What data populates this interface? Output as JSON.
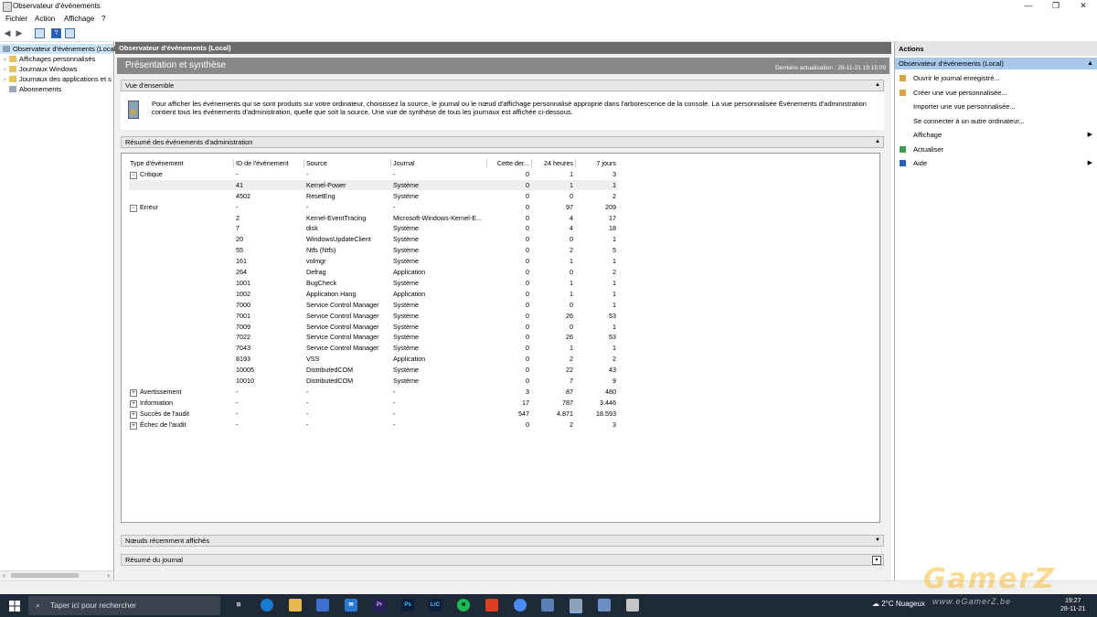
{
  "window": {
    "title": "Observateur d'événements",
    "minimize": "—",
    "restore": "❐",
    "close": "✕"
  },
  "menu": {
    "file": "Fichier",
    "action": "Action",
    "view": "Affichage",
    "help": "?"
  },
  "tree": {
    "root": "Observateur d'événements (Local)",
    "items": [
      "Affichages personnalisés",
      "Journaux Windows",
      "Journaux des applications et s",
      "Abonnements"
    ]
  },
  "center": {
    "header": "Observateur d'événements (Local)",
    "banner_title": "Présentation et synthèse",
    "last_refresh": "Dernière actualisation : 28-11-21 19:15:09",
    "overview_label": "Vue d'ensemble",
    "overview_text": "Pour afficher les événements qui se sont produits sur votre ordinateur, choisissez la source, le journal ou le nœud d'affichage personnalisé approprié dans l'arborescence de la console. La vue personnalisée Événements d'administration contient tous les événements d'administration, quelle que soit la source. Une vue de synthèse de tous les journaux est affichée ci-dessous.",
    "summary_label": "Résumé des événements d'administration",
    "recent_nodes_label": "Nœuds récemment affichés",
    "log_summary_label": "Résumé du journal"
  },
  "table": {
    "headers": [
      "Type d'événement",
      "ID de l'événement",
      "Source",
      "Journal",
      "Cette der...",
      "24 heures",
      "7 jours"
    ],
    "rows": [
      {
        "type": "Critique",
        "group": "minus",
        "id": "-",
        "source": "-",
        "journal": "-",
        "h1": "0",
        "h24": "1",
        "d7": "3"
      },
      {
        "type": "",
        "id": "41",
        "source": "Kernel-Power",
        "journal": "Système",
        "h1": "0",
        "h24": "1",
        "d7": "1",
        "alt": true
      },
      {
        "type": "",
        "id": "4502",
        "source": "ResetEng",
        "journal": "Système",
        "h1": "0",
        "h24": "0",
        "d7": "2"
      },
      {
        "type": "Erreur",
        "group": "minus",
        "id": "-",
        "source": "-",
        "journal": "-",
        "h1": "0",
        "h24": "97",
        "d7": "209"
      },
      {
        "type": "",
        "id": "2",
        "source": "Kernel-EventTracing",
        "journal": "Microsoft-Windows-Kernel-E...",
        "h1": "0",
        "h24": "4",
        "d7": "17"
      },
      {
        "type": "",
        "id": "7",
        "source": "disk",
        "journal": "Système",
        "h1": "0",
        "h24": "4",
        "d7": "18"
      },
      {
        "type": "",
        "id": "20",
        "source": "WindowsUpdateClient",
        "journal": "Système",
        "h1": "0",
        "h24": "0",
        "d7": "1"
      },
      {
        "type": "",
        "id": "55",
        "source": "Ntfs (Ntfs)",
        "journal": "Système",
        "h1": "0",
        "h24": "2",
        "d7": "5"
      },
      {
        "type": "",
        "id": "161",
        "source": "volmgr",
        "journal": "Système",
        "h1": "0",
        "h24": "1",
        "d7": "1"
      },
      {
        "type": "",
        "id": "264",
        "source": "Defrag",
        "journal": "Application",
        "h1": "0",
        "h24": "0",
        "d7": "2"
      },
      {
        "type": "",
        "id": "1001",
        "source": "BugCheck",
        "journal": "Système",
        "h1": "0",
        "h24": "1",
        "d7": "1"
      },
      {
        "type": "",
        "id": "1002",
        "source": "Application Hang",
        "journal": "Application",
        "h1": "0",
        "h24": "1",
        "d7": "1"
      },
      {
        "type": "",
        "id": "7000",
        "source": "Service Control Manager",
        "journal": "Système",
        "h1": "0",
        "h24": "0",
        "d7": "1"
      },
      {
        "type": "",
        "id": "7001",
        "source": "Service Control Manager",
        "journal": "Système",
        "h1": "0",
        "h24": "26",
        "d7": "53"
      },
      {
        "type": "",
        "id": "7009",
        "source": "Service Control Manager",
        "journal": "Système",
        "h1": "0",
        "h24": "0",
        "d7": "1"
      },
      {
        "type": "",
        "id": "7022",
        "source": "Service Control Manager",
        "journal": "Système",
        "h1": "0",
        "h24": "26",
        "d7": "53"
      },
      {
        "type": "",
        "id": "7043",
        "source": "Service Control Manager",
        "journal": "Système",
        "h1": "0",
        "h24": "1",
        "d7": "1"
      },
      {
        "type": "",
        "id": "8193",
        "source": "VSS",
        "journal": "Application",
        "h1": "0",
        "h24": "2",
        "d7": "2"
      },
      {
        "type": "",
        "id": "10005",
        "source": "DistributedCOM",
        "journal": "Système",
        "h1": "0",
        "h24": "22",
        "d7": "43"
      },
      {
        "type": "",
        "id": "10010",
        "source": "DistributedCOM",
        "journal": "Système",
        "h1": "0",
        "h24": "7",
        "d7": "9"
      },
      {
        "type": "Avertissement",
        "group": "plus",
        "id": "-",
        "source": "-",
        "journal": "-",
        "h1": "3",
        "h24": "87",
        "d7": "480"
      },
      {
        "type": "Information",
        "group": "plus",
        "id": "-",
        "source": "-",
        "journal": "-",
        "h1": "17",
        "h24": "787",
        "d7": "3.446"
      },
      {
        "type": "Succès de l'audit",
        "group": "plus",
        "id": "-",
        "source": "-",
        "journal": "-",
        "h1": "547",
        "h24": "4.871",
        "d7": "18.593"
      },
      {
        "type": "Échec de l'audit",
        "group": "plus",
        "id": "-",
        "source": "-",
        "journal": "-",
        "h1": "0",
        "h24": "2",
        "d7": "3"
      }
    ]
  },
  "actions": {
    "title": "Actions",
    "section": "Observateur d'événements (Local)",
    "items": [
      {
        "label": "Ouvrir le journal enregistré...",
        "icon": "folder-icon",
        "color": "#d9a23b"
      },
      {
        "label": "Créer une vue personnalisée...",
        "icon": "filter-icon",
        "color": "#d9a23b"
      },
      {
        "label": "Importer une vue personnalisée...",
        "icon": "",
        "color": ""
      },
      {
        "label": "Se connecter à un autre ordinateur...",
        "icon": "",
        "color": ""
      },
      {
        "label": "Affichage",
        "icon": "",
        "color": "",
        "submenu": true
      },
      {
        "label": "Actualiser",
        "icon": "refresh-icon",
        "color": "#3c9a4a"
      },
      {
        "label": "Aide",
        "icon": "help-icon",
        "color": "#2b5fbf",
        "submenu": true
      }
    ]
  },
  "taskbar": {
    "search_placeholder": "Taper ici pour rechercher",
    "weather": "2°C  Nuageux",
    "time": "19:27",
    "date": "28-11-21"
  },
  "watermark": {
    "logo": "GamerZ",
    "site": "www.eGamerZ.be"
  },
  "colors": {
    "center_header": "#6c6c6c",
    "banner": "#888888",
    "actions_selected": "#a7c8ea",
    "taskbar": "#1f2a38"
  }
}
